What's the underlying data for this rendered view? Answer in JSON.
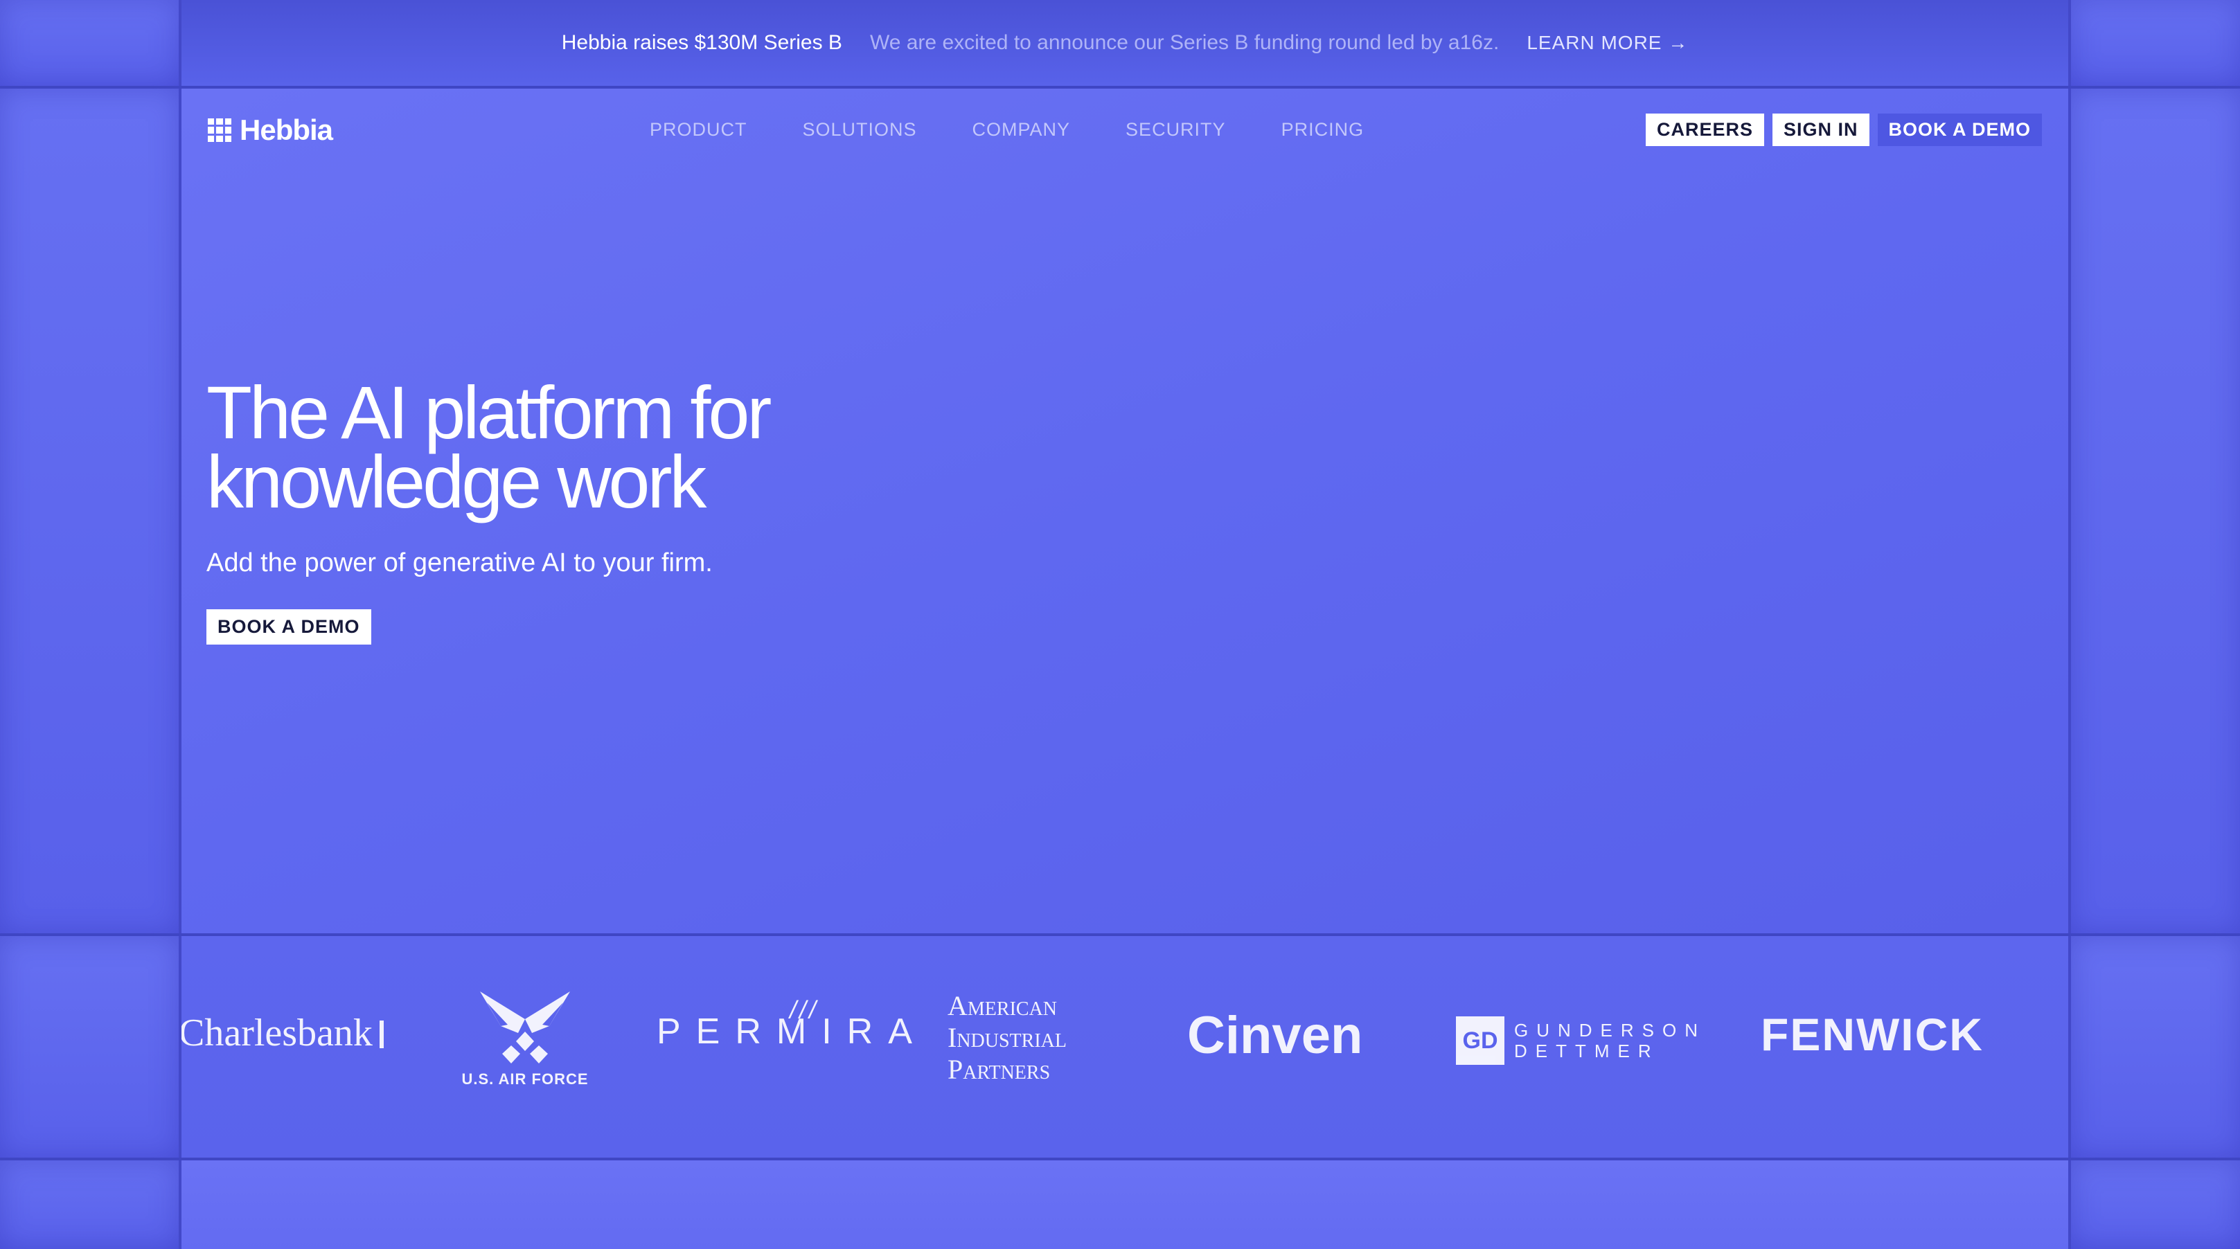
{
  "announcement": {
    "title": "Hebbia raises $130M Series B",
    "text": "We are excited to announce our Series B funding round led by a16z.",
    "link": "LEARN MORE →"
  },
  "header": {
    "logo_text": "Hebbia",
    "nav": [
      "PRODUCT",
      "SOLUTIONS",
      "COMPANY",
      "SECURITY",
      "PRICING"
    ],
    "careers": "CAREERS",
    "sign_in": "SIGN IN",
    "book_demo": "BOOK A DEMO"
  },
  "hero": {
    "headline_line1": "The AI platform for",
    "headline_line2": "knowledge work",
    "subhead": "Add the power of generative AI to your firm.",
    "cta": "BOOK A DEMO"
  },
  "logos": {
    "charlesbank": "Charlesbank",
    "air_force": "U.S. AIR FORCE",
    "permira": "PERMIRA",
    "american_line1": "American",
    "american_line2": "Industrial",
    "american_line3": "Partners",
    "cinven": "Cinven",
    "gunderson_mark": "GD",
    "gunderson_line1": "GUNDERSON",
    "gunderson_line2": "DETTMER",
    "fenwick": "FENWICK"
  },
  "colors": {
    "background": "#5862ea",
    "hero": "#6a72f4",
    "frame_line": "#4349c9"
  }
}
